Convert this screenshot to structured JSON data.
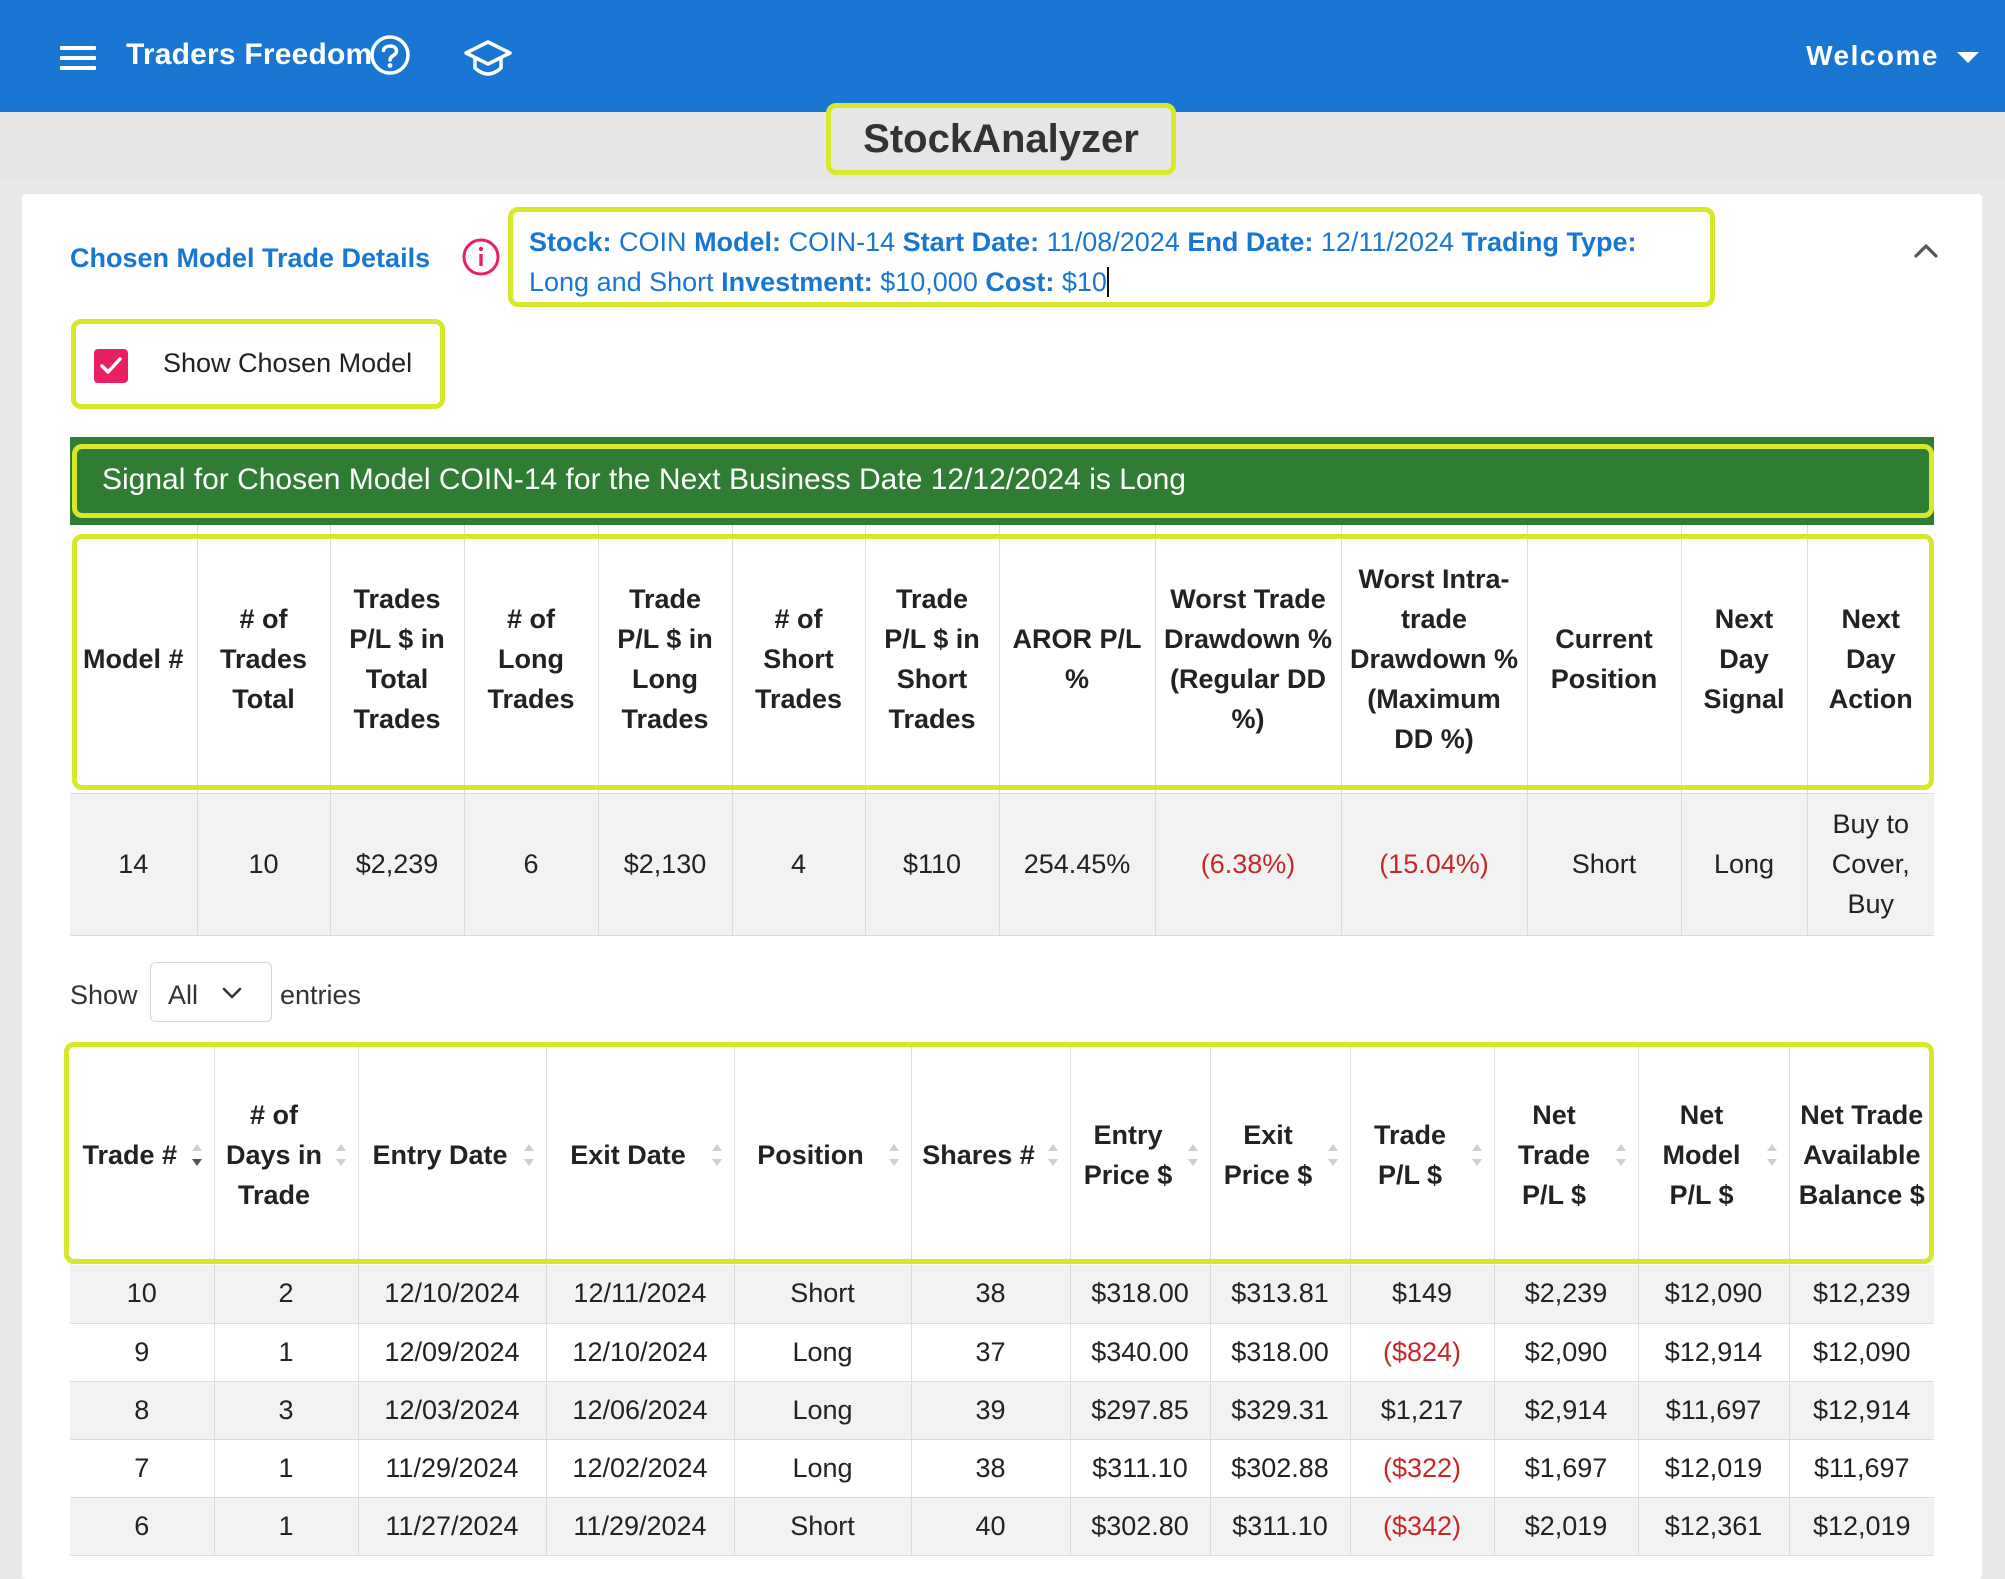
{
  "appbar": {
    "brand": "Traders Freedom",
    "welcome": "Welcome",
    "icons": [
      "menu-icon",
      "help-icon",
      "school-icon",
      "chevron-down-icon"
    ]
  },
  "page_title": "StockAnalyzer",
  "section": {
    "title": "Chosen Model Trade Details",
    "details": {
      "stock_label": "Stock:",
      "stock": "COIN",
      "model_label": "Model:",
      "model": "COIN-14",
      "start_label": "Start Date:",
      "start": "11/08/2024",
      "end_label": "End Date:",
      "end": "12/11/2024",
      "trading_type_label": "Trading Type:",
      "trading_type": "Long and Short",
      "investment_label": "Investment:",
      "investment": "$10,000",
      "cost_label": "Cost:",
      "cost": "$10"
    },
    "show_chosen_model": "Show Chosen Model",
    "show_chosen_model_checked": true
  },
  "signal": "Signal for Chosen Model COIN-14 for the Next Business Date 12/12/2024 is Long",
  "summary": {
    "headers": [
      "Model #",
      "# of Trades Total",
      "Trades P/L $ in Total Trades",
      "# of Long Trades",
      "Trade P/L $ in Long Trades",
      "# of Short Trades",
      "Trade P/L $ in Short Trades",
      "AROR P/L %",
      "Worst Trade Drawdown % (Regular DD %)",
      "Worst Intra-trade Drawdown % (Maximum DD %)",
      "Current Position",
      "Next Day Signal",
      "Next Day Action"
    ],
    "row": [
      "14",
      "10",
      "$2,239",
      "6",
      "$2,130",
      "4",
      "$110",
      "254.45%",
      "(6.38%)",
      "(15.04%)",
      "Short",
      "Long",
      "Buy to Cover, Buy"
    ]
  },
  "entries": {
    "show": "Show",
    "value": "All",
    "suffix": "entries"
  },
  "trades": {
    "headers": [
      "Trade #",
      "# of Days in Trade",
      "Entry Date",
      "Exit Date",
      "Position",
      "Shares #",
      "Entry Price $",
      "Exit Price $",
      "Trade P/L $",
      "Net Trade P/L $",
      "Net Model P/L $",
      "Net Trade Available Balance $"
    ],
    "rows": [
      [
        "10",
        "2",
        "12/10/2024",
        "12/11/2024",
        "Short",
        "38",
        "$318.00",
        "$313.81",
        "$149",
        "$2,239",
        "$12,090",
        "$12,239"
      ],
      [
        "9",
        "1",
        "12/09/2024",
        "12/10/2024",
        "Long",
        "37",
        "$340.00",
        "$318.00",
        "($824)",
        "$2,090",
        "$12,914",
        "$12,090"
      ],
      [
        "8",
        "3",
        "12/03/2024",
        "12/06/2024",
        "Long",
        "39",
        "$297.85",
        "$329.31",
        "$1,217",
        "$2,914",
        "$11,697",
        "$12,914"
      ],
      [
        "7",
        "1",
        "11/29/2024",
        "12/02/2024",
        "Long",
        "38",
        "$311.10",
        "$302.88",
        "($322)",
        "$1,697",
        "$12,019",
        "$11,697"
      ],
      [
        "6",
        "1",
        "11/27/2024",
        "11/29/2024",
        "Short",
        "40",
        "$302.80",
        "$311.10",
        "($342)",
        "$2,019",
        "$12,361",
        "$12,019"
      ]
    ]
  },
  "colors": {
    "appbar": "#1976d2",
    "highlight": "#d7e82b",
    "signal_bg": "#2e7d32",
    "negative": "#c62828",
    "checkbox": "#e91e63"
  }
}
